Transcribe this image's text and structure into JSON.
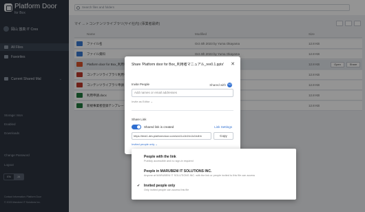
{
  "sidebar": {
    "app_title": "Platform Door",
    "app_subtitle": "for Box",
    "user_name": "岡山 悠真 IT Cres",
    "nav": [
      {
        "label": "All Files"
      },
      {
        "label": "Favorites"
      },
      {
        "label": "Current Shared Mal"
      }
    ],
    "footer_items": [
      "Storage: Mon",
      "Enabled",
      "Downloads"
    ],
    "change_password": "Change Password",
    "logout": "Logout",
    "lang": [
      "EN",
      "JA"
    ],
    "contact": "Contact Information: Platform Door",
    "copyright": "© 2023 Marubeni IT Solutions Inc."
  },
  "topbar": {
    "search_placeholder": "Search files and folders"
  },
  "breadcrumb": "マイ ... > コンテンツライブラリ(サイ社内) (事業者最終)",
  "table": {
    "headers": {
      "name": "Name",
      "modified": "Modified",
      "size": "Size"
    },
    "rows": [
      {
        "name": "ファイル名",
        "modified": "Oct 4th 2023 by Yuma Okayama",
        "size": "12.8 KB",
        "type": "folder"
      },
      {
        "name": "ファイル資料",
        "modified": "Oct 4th 2023 by Yuma Okayama",
        "size": "12.8 KB",
        "type": "folder"
      },
      {
        "name": "Platform door for Box_利用者マニュアル_rev0.1.pptx",
        "modified": "Oct 4th 2023 by Yuma Okayama",
        "size": "12.8 KB",
        "type": "pptx",
        "open": "Open",
        "share": "Share"
      },
      {
        "name": "コンテンツライブラリ利用手順",
        "modified": "Oct 4th 2023 by Yuma Okayama",
        "size": "12.8 KB",
        "type": "pdf"
      },
      {
        "name": "コンテンツライブラリ申請",
        "modified": "Oct 4th 2023 by Yuma Okayama",
        "size": "12.8 KB",
        "type": "pdf"
      },
      {
        "name": "利用申請.docx",
        "modified": "Oct 4th 2023 by Yuma Okayama",
        "size": "12.8 KB",
        "type": "xlsx"
      },
      {
        "name": "新規事業者登録テンプレート",
        "modified": "Oct 4th 2023 by Yuma Okayama",
        "size": "12.8 KB",
        "type": "xlsx"
      }
    ]
  },
  "dialog": {
    "title": "Share 'Platform door for Box_利用者マニュアル_rev0.1.pptx'",
    "invite_label": "Invite People",
    "shared_with": "Shared with",
    "shared_count": "YO",
    "invite_placeholder": "Add names or email addresses",
    "invite_role": "Invite as Editor ⌄",
    "share_link_label": "Share Link",
    "link_created": "Shared link is created",
    "link_settings": "Link Settings",
    "link_url": "https://test1.dev.platformdoor.com/s/x41o1b1fcIJz1hdhh",
    "copy": "Copy",
    "access_selector": "Invited people only ⌄"
  },
  "menu": {
    "options": [
      {
        "title": "People with the link",
        "desc": "Publicly accessible and no sign-in required"
      },
      {
        "title": "People in MARUBENI IT SOLUTIONS INC.",
        "desc": "Anyone at MARUBENI IT SOLUTIONS INC. with the link or people invited to this file can access"
      },
      {
        "title": "Invited people only",
        "desc": "Only invited people can access this file",
        "selected": true
      }
    ]
  },
  "colors": {
    "sidebar_bg": "#2d3440",
    "accent": "#2f6fd1",
    "folder": "#3a7bd5",
    "pptx": "#d9532c",
    "pdf": "#c0392b",
    "xlsx": "#1f7a3e"
  }
}
